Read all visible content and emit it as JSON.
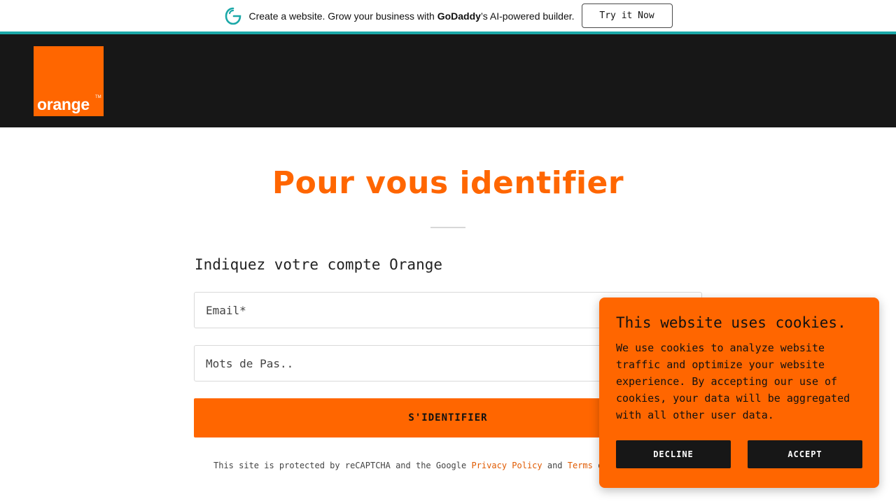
{
  "promo": {
    "text_before": "Create a website. Grow your business with ",
    "brand": "GoDaddy",
    "text_after": "’s AI-powered builder.",
    "cta_label": "Try it Now",
    "accent_color": "#1ba8a8"
  },
  "header": {
    "logo_text": "orange",
    "logo_tm": "TM",
    "brand_color": "#ff6600"
  },
  "main": {
    "title": "Pour vous identifier",
    "subtitle": "Indiquez votre compte Orange",
    "email_placeholder": "Email*",
    "password_placeholder": "Mots de Pas..",
    "submit_label": "S'IDENTIFIER",
    "recaptcha": {
      "text1": "This site is protected by reCAPTCHA and the Google ",
      "privacy_link": "Privacy Policy",
      "and": " and ",
      "terms_link": "Terms",
      "trailing": " o"
    }
  },
  "cookie_banner": {
    "title": "This website uses cookies.",
    "text": "We use cookies to analyze website traffic and optimize your website experience. By accepting our use of cookies, your data will be aggregated with all other user data.",
    "decline_label": "DECLINE",
    "accept_label": "ACCEPT"
  },
  "icons": {
    "promo_logo": "godaddy-logo-icon"
  }
}
